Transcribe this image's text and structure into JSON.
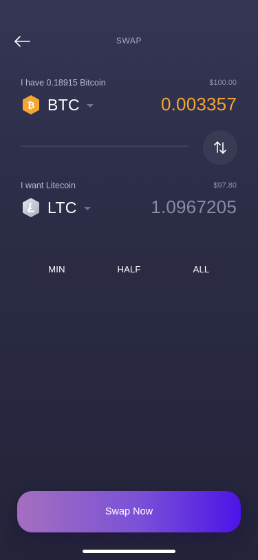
{
  "header": {
    "title": "SWAP"
  },
  "from": {
    "label": "I have 0.18915 Bitcoin",
    "fiat_value": "$100.00",
    "ticker": "BTC",
    "amount": "0.003357",
    "icon": "bitcoin-icon",
    "color": "#f3a634"
  },
  "to": {
    "label": "I want Litecoin",
    "fiat_value": "$97.80",
    "ticker": "LTC",
    "amount": "1.0967205",
    "icon": "litecoin-icon",
    "color": "#8a8ca5"
  },
  "quick_amounts": [
    "MIN",
    "HALF",
    "ALL"
  ],
  "cta": {
    "label": "Swap Now"
  },
  "colors": {
    "background": "#2b2c46",
    "accent_start": "#a46fbf",
    "accent_end": "#4c14e8",
    "btc_orange": "#f3a634"
  }
}
